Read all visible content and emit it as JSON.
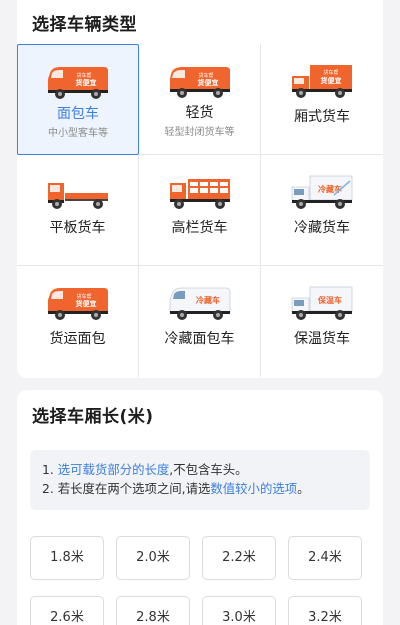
{
  "vehicle_section": {
    "title": "选择车辆类型",
    "items": [
      {
        "name": "面包车",
        "sub": "中小型客车等",
        "icon": "van-orange-icon",
        "selected": true
      },
      {
        "name": "轻货",
        "sub": "轻型封闭货车等",
        "icon": "light-van-orange-icon",
        "selected": false
      },
      {
        "name": "厢式货车",
        "sub": "",
        "icon": "box-truck-orange-icon",
        "selected": false
      },
      {
        "name": "平板货车",
        "sub": "",
        "icon": "flatbed-truck-icon",
        "selected": false
      },
      {
        "name": "高栏货车",
        "sub": "",
        "icon": "high-rail-truck-icon",
        "selected": false
      },
      {
        "name": "冷藏货车",
        "sub": "",
        "icon": "refrigerated-truck-icon",
        "selected": false
      },
      {
        "name": "货运面包",
        "sub": "",
        "icon": "cargo-van-icon",
        "selected": false
      },
      {
        "name": "冷藏面包车",
        "sub": "",
        "icon": "refrigerated-van-icon",
        "selected": false
      },
      {
        "name": "保温货车",
        "sub": "",
        "icon": "insulated-truck-icon",
        "selected": false
      }
    ]
  },
  "length_section": {
    "title": "选择车厢长(米)",
    "notice": {
      "line1_prefix": "1. ",
      "line1_hl": "选可载货部分的长度",
      "line1_suffix": ",不包含车头。",
      "line2_prefix": "2. 若长度在两个选项之间,请选",
      "line2_hl": "数值较小的选项",
      "line2_suffix": "。"
    },
    "options": [
      "1.8米",
      "2.0米",
      "2.2米",
      "2.4米",
      "2.6米",
      "2.8米",
      "3.0米",
      "3.2米"
    ]
  },
  "colors": {
    "accent": "#3d7fe0",
    "truck_orange": "#f0642e",
    "selected_bg": "#eef4fd"
  }
}
